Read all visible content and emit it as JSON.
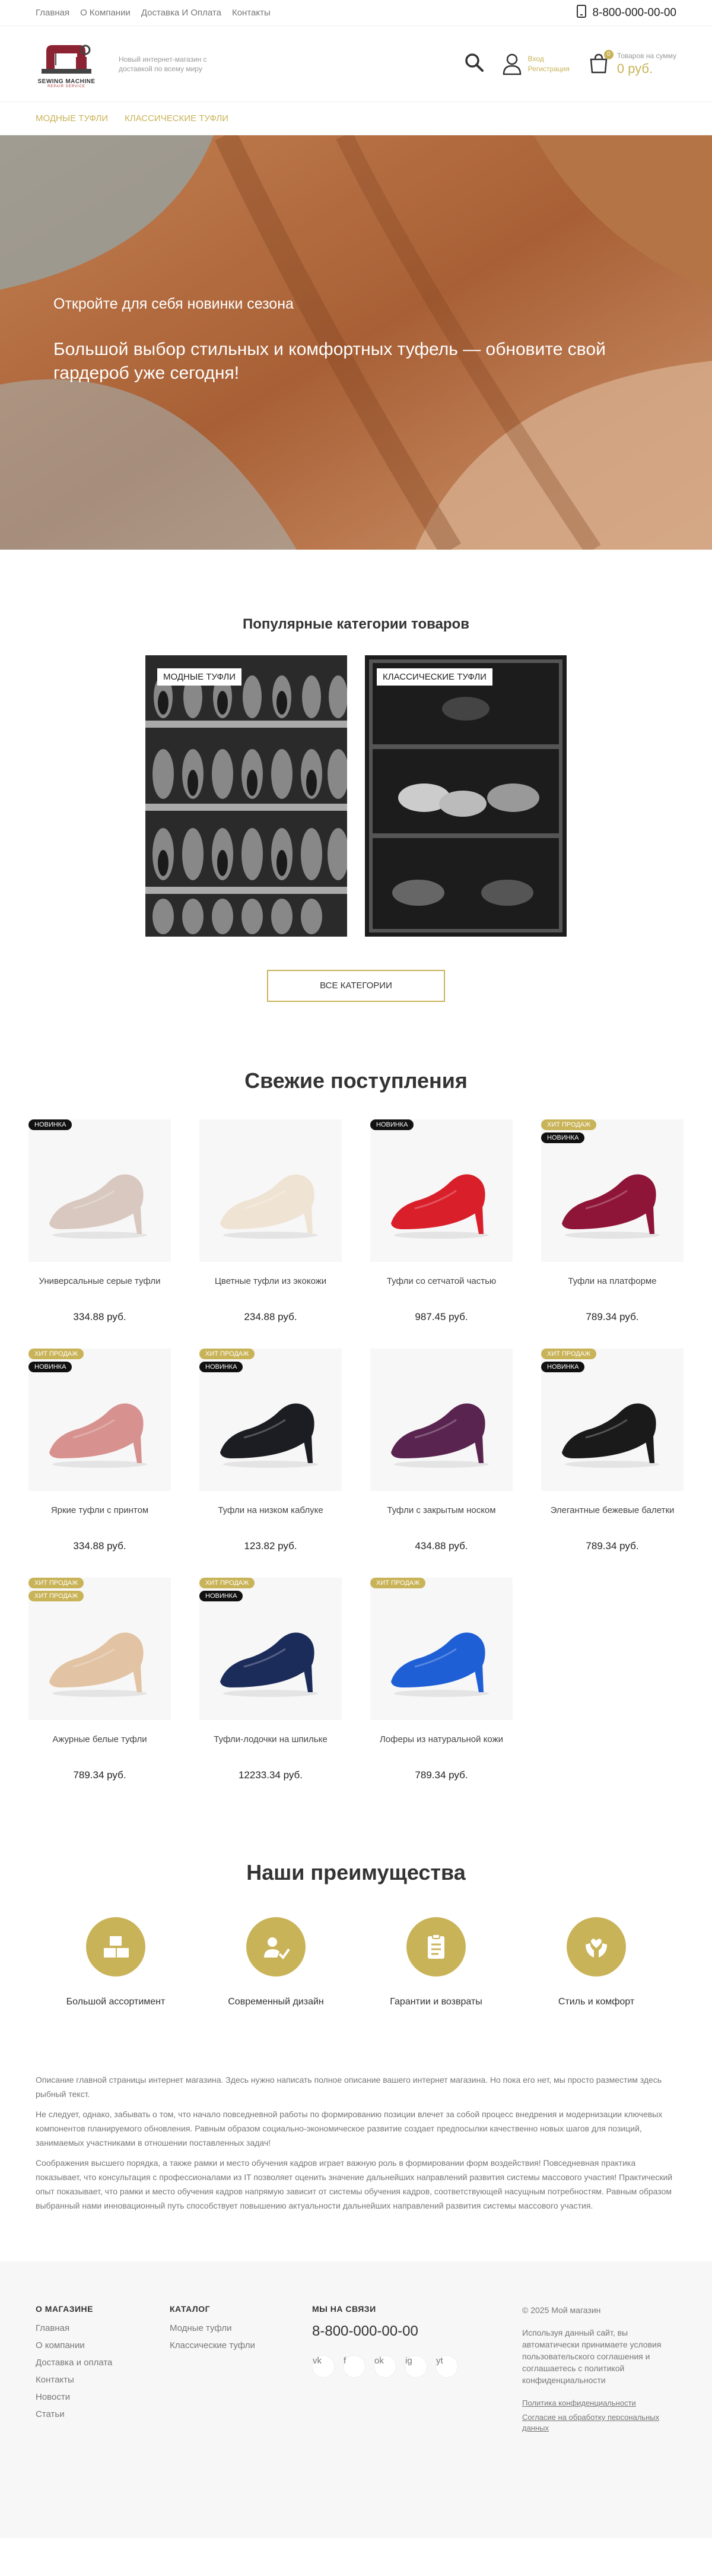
{
  "topbar": {
    "links": [
      "Главная",
      "О Компании",
      "Доставка И Оплата",
      "Контакты"
    ],
    "phone": "8-800-000-00-00"
  },
  "header": {
    "logo_line1": "SEWING MACHINE",
    "logo_line2": "REPAIR SERVICE",
    "tagline": "Новый интернет-магазин с доставкой по всему миру",
    "account_login": "Вход",
    "account_register": "Регистрация",
    "cart_label": "Товаров на сумму",
    "cart_count": "0",
    "cart_sum": "0 руб."
  },
  "catnav": [
    "Модные туфли",
    "Классические туфли"
  ],
  "hero": {
    "title": "Откройте для себя новинки сезона",
    "subtitle": "Большой выбор стильных и комфортных туфель — обновите свой гардероб уже сегодня!"
  },
  "popular": {
    "title": "Популярные категории товаров",
    "categories": [
      "Модные туфли",
      "Классические туфли"
    ],
    "all_button": "Все категории"
  },
  "new_arrivals": {
    "title": "Свежие поступления",
    "products": [
      {
        "name": "Универсальные серые туфли",
        "price": "334.88 руб.",
        "badges": [
          "Новинка"
        ],
        "color": "#d9c8c0"
      },
      {
        "name": "Цветные туфли из экокожи",
        "price": "234.88 руб.",
        "badges": [],
        "color": "#efe3d4"
      },
      {
        "name": "Туфли со сетчатой частью",
        "price": "987.45 руб.",
        "badges": [
          "Новинка"
        ],
        "color": "#d91f2a"
      },
      {
        "name": "Туфли на платформе",
        "price": "789.34 руб.",
        "badges": [
          "Хит продаж",
          "Новинка"
        ],
        "color": "#8e1438"
      },
      {
        "name": "Яркие туфли с принтом",
        "price": "334.88 руб.",
        "badges": [
          "Хит продаж",
          "Новинка"
        ],
        "color": "#d7928f"
      },
      {
        "name": "Туфли на низком каблуке",
        "price": "123.82 руб.",
        "badges": [
          "Хит продаж",
          "Новинка"
        ],
        "color": "#1b1d22"
      },
      {
        "name": "Туфли с закрытым носком",
        "price": "434.88 руб.",
        "badges": [],
        "color": "#5a2450"
      },
      {
        "name": "Элегантные бежевые балетки",
        "price": "789.34 руб.",
        "badges": [
          "Хит продаж",
          "Новинка"
        ],
        "color": "#1a1a1a"
      },
      {
        "name": "Ажурные белые туфли",
        "price": "789.34 руб.",
        "badges": [
          "Хит продаж",
          "Хит продаж"
        ],
        "color": "#e2c3a4"
      },
      {
        "name": "Туфли-лодочки на шпильке",
        "price": "12233.34 руб.",
        "badges": [
          "Хит продаж",
          "Новинка"
        ],
        "color": "#1c2c5a"
      },
      {
        "name": "Лоферы из натуральной кожи",
        "price": "789.34 руб.",
        "badges": [
          "Хит продаж"
        ],
        "color": "#1f5fd6"
      }
    ]
  },
  "advantages": {
    "title": "Наши преимущества",
    "items": [
      {
        "label": "Большой ассортимент",
        "icon": "boxes-icon"
      },
      {
        "label": "Современный дизайн",
        "icon": "design-icon"
      },
      {
        "label": "Гарантии и возвраты",
        "icon": "clipboard-icon"
      },
      {
        "label": "Стиль и комфорт",
        "icon": "hands-icon"
      }
    ]
  },
  "description": [
    "Описание главной страницы интернет магазина. Здесь нужно написать полное описание вашего интернет магазина. Но пока его нет, мы просто разместим здесь рыбный текст.",
    "Не следует, однако, забывать о том, что начало повседневной работы по формированию позиции влечет за собой процесс внедрения и модернизации ключевых компонентов планируемого обновления. Равным образом социально-экономическое развитие создает предпосылки качественно новых шагов для позиций, занимаемых участниками в отношении поставленных задач!",
    "Соображения высшего порядка, а также рамки и место обучения кадров играет важную роль в формировании форм воздействия! Повседневная практика показывает, что консультация с профессионалами из IT позволяет оценить значение дальнейших направлений развития системы массового участия! Практический опыт показывает, что рамки и место обучения кадров напрямую зависит от системы обучения кадров, соответствующей насущным потребностям. Равным образом выбранный нами инновационный путь способствует повышению актуальности дальнейших направлений развития системы массового участия."
  ],
  "footer": {
    "about_title": "О магазине",
    "about_links": [
      "Главная",
      "О компании",
      "Доставка и оплата",
      "Контакты",
      "Новости",
      "Статьи"
    ],
    "catalog_title": "Каталог",
    "catalog_links": [
      "Модные туфли",
      "Классические туфли"
    ],
    "contact_title": "Мы на связи",
    "phone": "8-800-000-00-00",
    "socials": [
      "vk",
      "f",
      "ok",
      "ig",
      "yt"
    ],
    "copyright": "© 2025 Мой магазин",
    "notice": "Используя данный сайт, вы автоматически принимаете условия пользовательского соглашения и соглашаетесь с политикой конфиденциальности",
    "privacy": "Политика конфиденциальности",
    "consent": "Согласие на обработку персональных данных"
  }
}
